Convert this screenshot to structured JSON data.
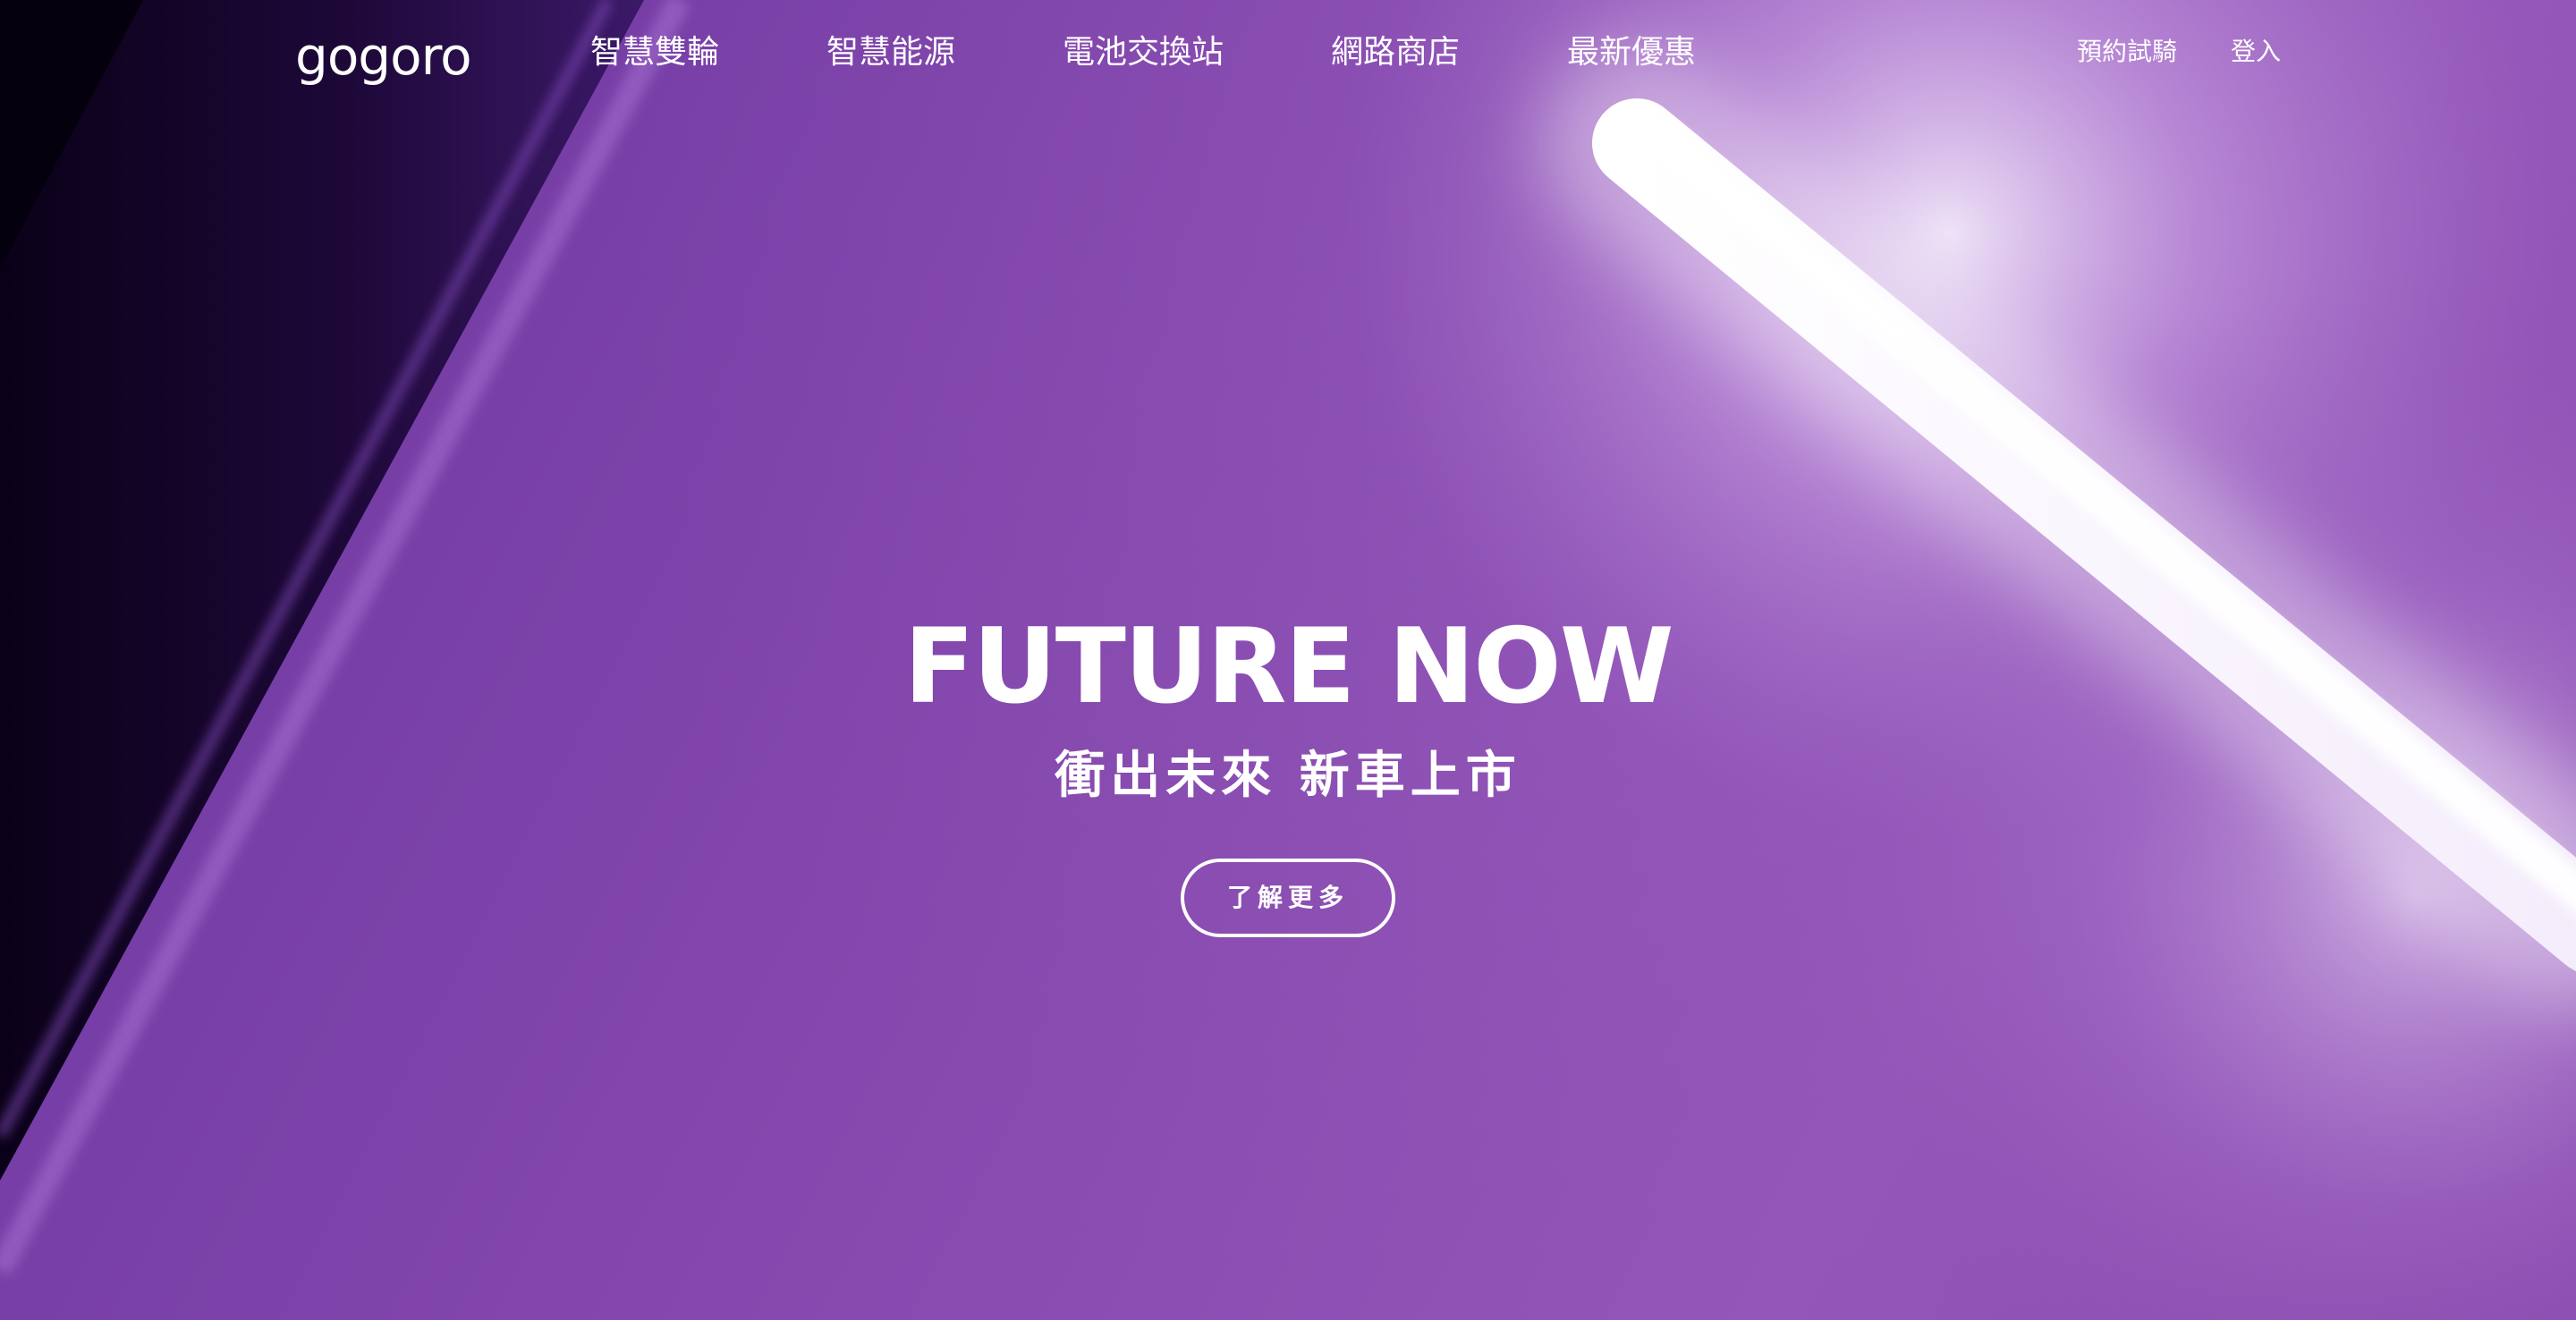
{
  "brand": {
    "logo_text": "gogoro",
    "accent_color": "#8a4fb0"
  },
  "nav": {
    "items": [
      {
        "label": "智慧雙輪"
      },
      {
        "label": "智慧能源"
      },
      {
        "label": "電池交換站"
      },
      {
        "label": "網路商店"
      },
      {
        "label": "最新優惠"
      }
    ],
    "test_ride_label": "預約試騎",
    "login_label": "登入"
  },
  "hero": {
    "headline": "FUTURE NOW",
    "subheadline": "衝出未來 新車上市",
    "cta_label": "了解更多"
  }
}
